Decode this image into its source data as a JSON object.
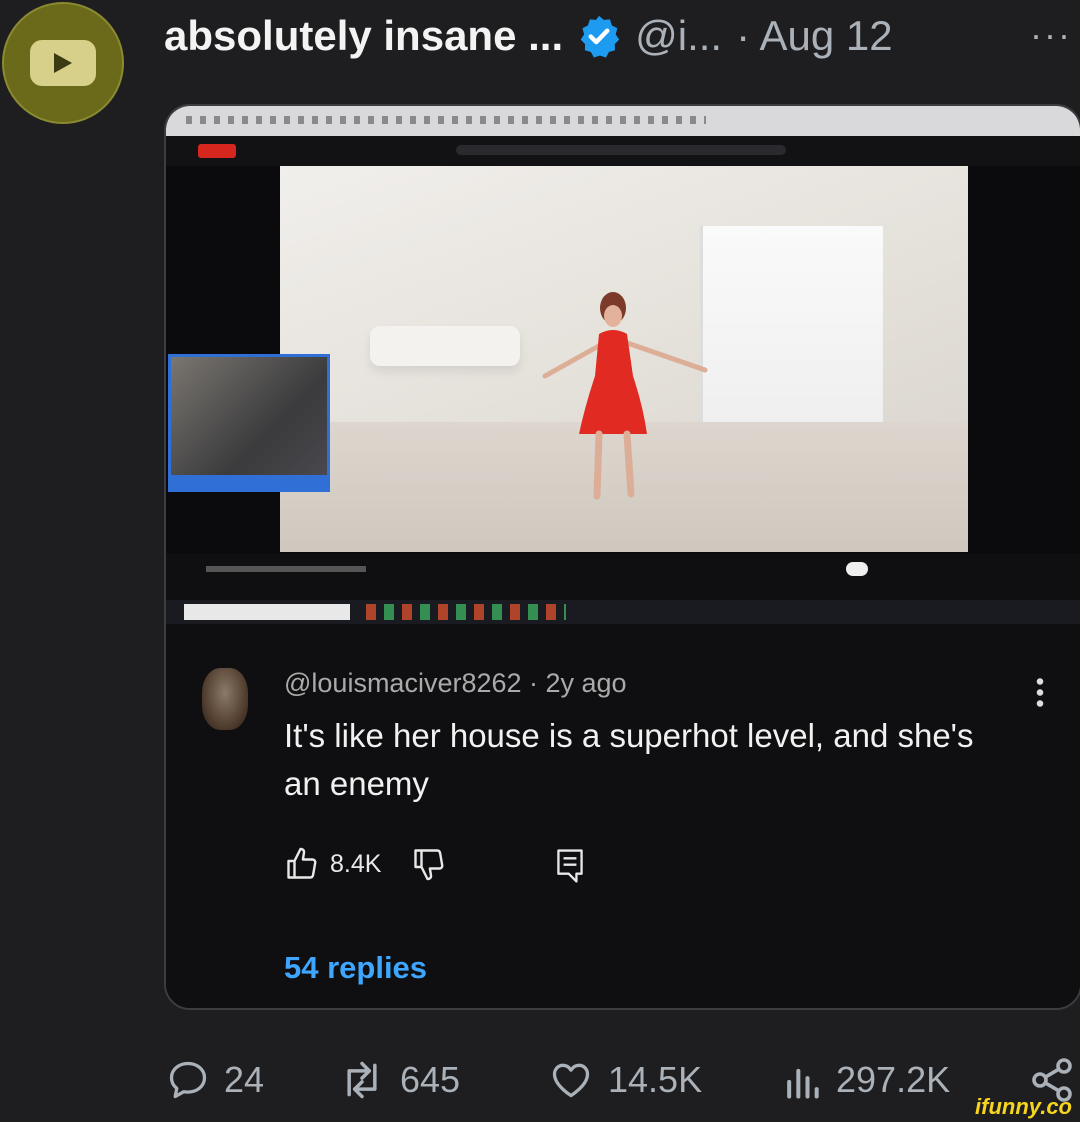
{
  "post": {
    "author_name": "absolutely insane ...",
    "handle": "@i...",
    "date": "· Aug 12",
    "more": "···"
  },
  "comment": {
    "username": "@louismaciver8262 · 2y ago",
    "text": "It's like her house is a superhot level, and she's an enemy",
    "likes": "8.4K",
    "replies": "54 replies"
  },
  "stats": {
    "replies": "24",
    "reposts": "645",
    "likes": "14.5K",
    "views": "297.2K"
  },
  "watermark": "ifunny.co",
  "colors": {
    "background": "#1e1e20",
    "verified": "#1d9bf0",
    "replies_link": "#3ea6ff",
    "dress": "#e02a22"
  }
}
